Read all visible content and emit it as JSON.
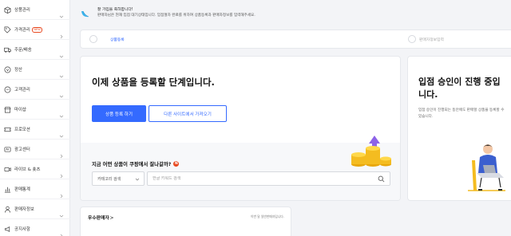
{
  "sidebar": {
    "items": [
      {
        "label": "상품관리",
        "icon": "box-icon",
        "chevron": "down"
      },
      {
        "label": "가격관리",
        "icon": "price-tag-icon",
        "chevron": "right",
        "badge": "NEW"
      },
      {
        "label": "주문/배송",
        "icon": "truck-icon",
        "chevron": "down"
      },
      {
        "label": "정산",
        "icon": "coin-icon",
        "chevron": "down"
      },
      {
        "label": "고객관리",
        "icon": "chat-icon",
        "chevron": "down"
      },
      {
        "label": "마이샵",
        "icon": "shop-icon",
        "chevron": "down"
      },
      {
        "label": "프로모션",
        "icon": "ticket-icon",
        "chevron": "down"
      },
      {
        "label": "광고센터",
        "icon": "ad-icon",
        "chevron": "right"
      },
      {
        "label": "라이브 & 숏츠",
        "icon": "live-icon",
        "chevron": "right"
      },
      {
        "label": "판매통계",
        "icon": "stats-icon",
        "chevron": "right"
      },
      {
        "label": "판매자정보",
        "icon": "user-icon",
        "chevron": "down"
      },
      {
        "label": "공지사항",
        "icon": "megaphone-icon",
        "chevron": "right"
      }
    ]
  },
  "notice": {
    "title": "잘 가입을 축하합니다!",
    "subtitle": "판매자님은 현재 입점 대기상태입니다. 입점절차 완료를 위하여 상품등록과 판매자정보를 입력해주세요."
  },
  "steps": [
    {
      "label": "상품등록",
      "active": true
    },
    {
      "label": "판매자정보입력",
      "active": false
    }
  ],
  "main": {
    "title": "이제 상품을 등록할 단계입니다.",
    "primary_button": "상품 등록 하기",
    "secondary_button": "다른 사이트에서 가져오기",
    "question": "지금 어떤 상품이 쿠팡에서 잘나갈까?",
    "question_badge": "N",
    "category_select": "카테고리 검색",
    "search_placeholder": "한글 키워드 검색"
  },
  "side_card": {
    "title": "입점 승인이 진행 중입니다.",
    "description": "입점 승인이 진행되는 동안에도 판매할 상품을 등록할 수 있습니다."
  },
  "best_sellers": {
    "title": "우수판매자",
    "chevron": ">",
    "note": "이번 달 일반판매자입니다."
  },
  "colors": {
    "accent": "#346aff",
    "badge": "#e8481f",
    "background": "#f3f4f7"
  }
}
